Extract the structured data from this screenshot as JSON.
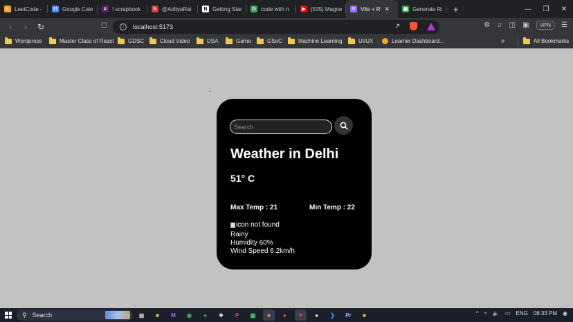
{
  "browser": {
    "tabs": [
      {
        "title": "LeetCode - T",
        "favicon": "leetcode-icon",
        "color": "#ffa116",
        "glyph": "L"
      },
      {
        "title": "Google Cale",
        "favicon": "google-calendar-icon",
        "color": "#4285f4",
        "glyph": "31"
      },
      {
        "title": "! scrapbook",
        "favicon": "slack-icon",
        "color": "#611f69",
        "glyph": "#"
      },
      {
        "title": "@AdityaRai",
        "favicon": "hashnode-icon",
        "color": "#d9363e",
        "glyph": "h"
      },
      {
        "title": "Getting Start",
        "favicon": "notion-icon",
        "color": "#ffffff",
        "glyph": "N"
      },
      {
        "title": "code with n",
        "favicon": "chrome-icon",
        "color": "#34a853",
        "glyph": "G"
      },
      {
        "title": "(535) Magne",
        "favicon": "youtube-icon",
        "color": "#ff0000",
        "glyph": "▶"
      },
      {
        "title": "Vite + R",
        "favicon": "vite-icon",
        "color": "#9b6cff",
        "glyph": "V",
        "active": true
      },
      {
        "title": "Generate Ra",
        "favicon": "generator-icon",
        "color": "#2ea44f",
        "glyph": "▦"
      }
    ],
    "new_tab": "+",
    "address": "localhost:5173",
    "vpn_label": "VPN",
    "bookmarks": [
      {
        "label": "Wordpress",
        "type": "folder"
      },
      {
        "label": "Master Class of React",
        "type": "folder"
      },
      {
        "label": "GDSC",
        "type": "folder"
      },
      {
        "label": "Cloud Video",
        "type": "folder"
      },
      {
        "label": "DSA",
        "type": "folder"
      },
      {
        "label": "Game",
        "type": "folder"
      },
      {
        "label": "GSoC",
        "type": "folder"
      },
      {
        "label": "Machine Learning",
        "type": "folder"
      },
      {
        "label": "UI/UX",
        "type": "folder"
      },
      {
        "label": "Learner Dashboard...",
        "type": "link"
      }
    ],
    "bookmarks_more": "»",
    "all_bookmarks": "All Bookmarks"
  },
  "page": {
    "stray_text": ";",
    "search": {
      "placeholder": "Search",
      "value": ""
    },
    "title": "Weather in Delhi",
    "temperature": "51° C",
    "max_temp": "Max Temp : 21",
    "min_temp": "Min Temp : 22",
    "icon_alt": "icon not found",
    "condition": "Rainy",
    "humidity": "Humidity 60%",
    "wind": "Wind Speed 6.2km/h"
  },
  "taskbar": {
    "search_label": "Search",
    "language": "ENG",
    "time": "08:33 PM"
  }
}
